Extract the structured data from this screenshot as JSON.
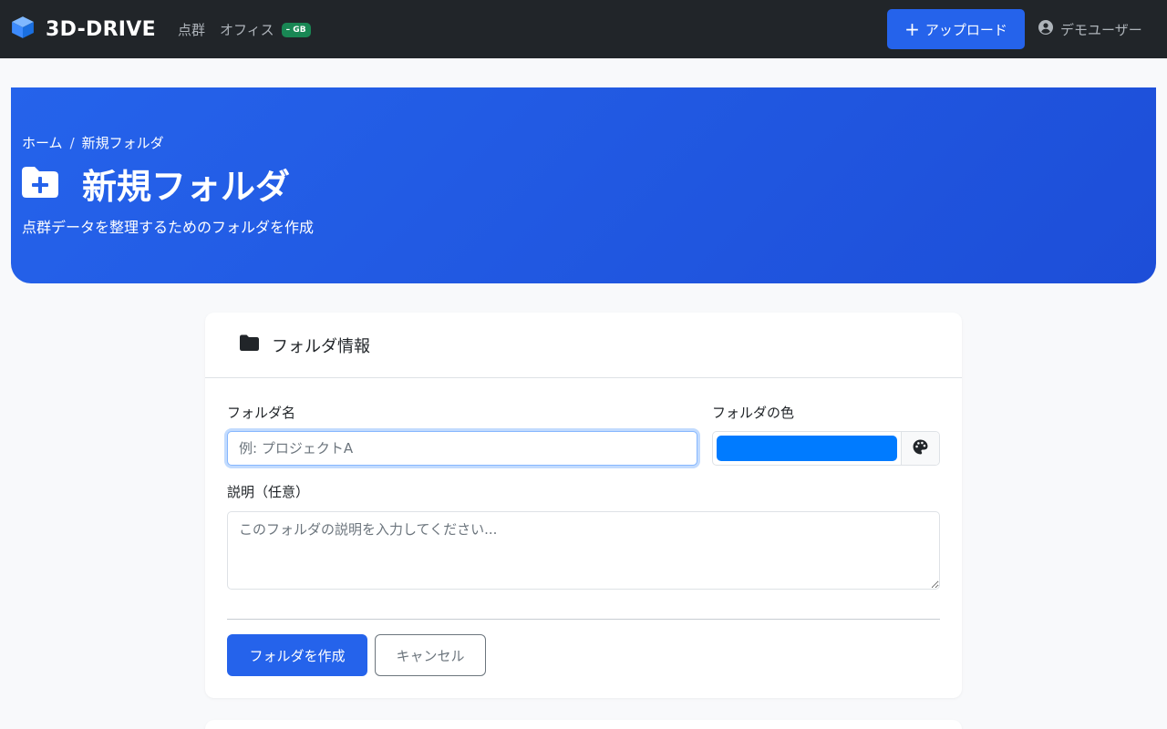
{
  "navbar": {
    "brand": "3D-DRIVE",
    "links": [
      "点群",
      "オフィス"
    ],
    "storage_badge": "– GB",
    "upload_label": "アップロード",
    "user_label": "デモユーザー"
  },
  "hero": {
    "breadcrumb": [
      "ホーム",
      "新規フォルダ"
    ],
    "breadcrumb_sep": "/",
    "title": "新規フォルダ",
    "subtitle": "点群データを整理するためのフォルダを作成"
  },
  "form": {
    "header": "フォルダ情報",
    "name_label": "フォルダ名",
    "name_placeholder": "例: プロジェクトA",
    "name_value": "",
    "color_label": "フォルダの色",
    "color_value": "#007bff",
    "description_label": "説明（任意）",
    "description_placeholder": "このフォルダの説明を入力してください...",
    "create_label": "フォルダを作成",
    "cancel_label": "キャンセル"
  },
  "colors": {
    "navbar_bg": "#212529",
    "accent": "#2563eb",
    "badge": "#198754"
  },
  "icons": {
    "brand": "cube-icon",
    "upload": "plus-icon",
    "user": "user-circle-icon",
    "hero": "folder-plus-icon",
    "card": "folder-icon",
    "palette": "palette-icon"
  }
}
